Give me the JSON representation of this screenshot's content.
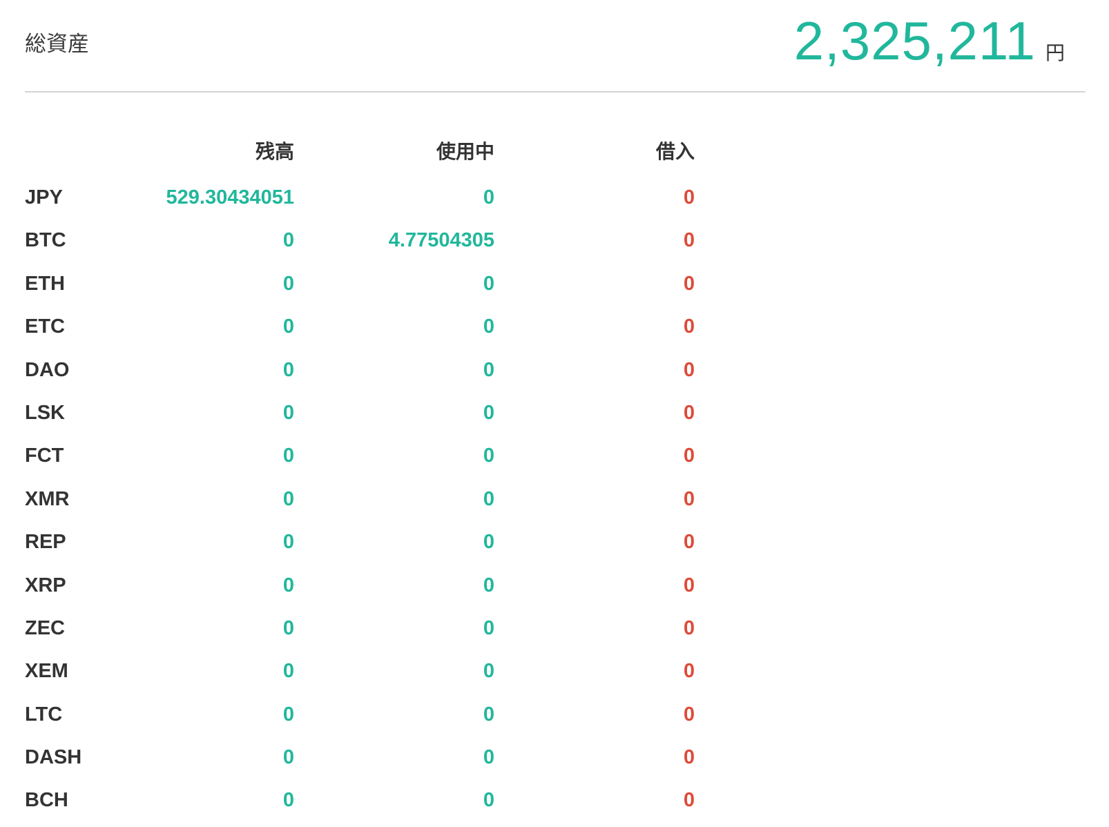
{
  "summary": {
    "label": "総資産",
    "total_value": "2,325,211",
    "total_unit": "円"
  },
  "table": {
    "headers": {
      "balance": "残高",
      "in_use": "使用中",
      "borrowed": "借入"
    },
    "rows": [
      {
        "symbol": "JPY",
        "balance": "529.30434051",
        "in_use": "0",
        "borrowed": "0"
      },
      {
        "symbol": "BTC",
        "balance": "0",
        "in_use": "4.77504305",
        "borrowed": "0"
      },
      {
        "symbol": "ETH",
        "balance": "0",
        "in_use": "0",
        "borrowed": "0"
      },
      {
        "symbol": "ETC",
        "balance": "0",
        "in_use": "0",
        "borrowed": "0"
      },
      {
        "symbol": "DAO",
        "balance": "0",
        "in_use": "0",
        "borrowed": "0"
      },
      {
        "symbol": "LSK",
        "balance": "0",
        "in_use": "0",
        "borrowed": "0"
      },
      {
        "symbol": "FCT",
        "balance": "0",
        "in_use": "0",
        "borrowed": "0"
      },
      {
        "symbol": "XMR",
        "balance": "0",
        "in_use": "0",
        "borrowed": "0"
      },
      {
        "symbol": "REP",
        "balance": "0",
        "in_use": "0",
        "borrowed": "0"
      },
      {
        "symbol": "XRP",
        "balance": "0",
        "in_use": "0",
        "borrowed": "0"
      },
      {
        "symbol": "ZEC",
        "balance": "0",
        "in_use": "0",
        "borrowed": "0"
      },
      {
        "symbol": "XEM",
        "balance": "0",
        "in_use": "0",
        "borrowed": "0"
      },
      {
        "symbol": "LTC",
        "balance": "0",
        "in_use": "0",
        "borrowed": "0"
      },
      {
        "symbol": "DASH",
        "balance": "0",
        "in_use": "0",
        "borrowed": "0"
      },
      {
        "symbol": "BCH",
        "balance": "0",
        "in_use": "0",
        "borrowed": "0"
      }
    ]
  },
  "colors": {
    "positive": "#21b79c",
    "borrowed": "#dd4b39",
    "text": "#333333",
    "divider": "#d4d4d4"
  }
}
